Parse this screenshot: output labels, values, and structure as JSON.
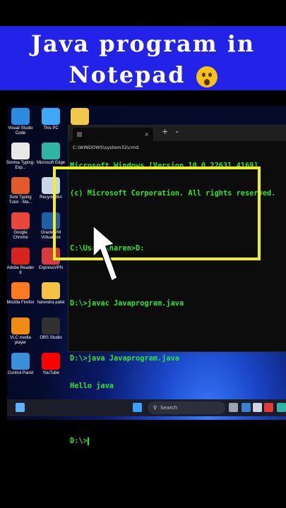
{
  "banner": {
    "line1": "Java program in",
    "line2": "Notepad",
    "emoji": "astonished-face"
  },
  "desktop_icons": [
    {
      "id": "vscode",
      "label": "Visual Studio Code",
      "color": "#2b8be0"
    },
    {
      "id": "thispc",
      "label": "This PC",
      "color": "#3fa9f5"
    },
    {
      "id": "folder",
      "label": "",
      "color": "#f2c84b"
    },
    {
      "id": "sonma",
      "label": "Sonma Typing-Exp...",
      "color": "#e8e8e8"
    },
    {
      "id": "edge",
      "label": "Microsoft Edge",
      "color": "#2fb5a3"
    },
    {
      "id": "soni",
      "label": "Soni Typing Tutor - Ma...",
      "color": "#e05a2b"
    },
    {
      "id": "recycle",
      "label": "Recycle Bin",
      "color": "#c9d6e8"
    },
    {
      "id": "chrome",
      "label": "Google Chrome",
      "color": "#e8453c"
    },
    {
      "id": "virtualbox",
      "label": "Oracle VM VirtualBox",
      "color": "#1f5fa8"
    },
    {
      "id": "adobe",
      "label": "Adobe Reader 8",
      "color": "#d8231f"
    },
    {
      "id": "expressvpn",
      "label": "ExpressVPN",
      "color": "#da3940"
    },
    {
      "id": "firefox",
      "label": "Mozilla Firefox",
      "color": "#ff7a1f"
    },
    {
      "id": "harendra",
      "label": "harendra patel",
      "color": "#f5c244"
    },
    {
      "id": "vlc",
      "label": "VLC media player",
      "color": "#f08a12"
    },
    {
      "id": "obs",
      "label": "OBS Studio",
      "color": "#303030"
    },
    {
      "id": "controlpanel",
      "label": "Control Panel",
      "color": "#3a8fd8"
    },
    {
      "id": "youtube",
      "label": "YouTube",
      "color": "#ff0000"
    }
  ],
  "terminal": {
    "tab_title": "C:\\WINDOWS\\system32\\cmd.",
    "tab_close": "×",
    "new_tab": "+",
    "dropdown": "⌄",
    "lines": [
      "Microsoft Windows [Version 10.0.22631.4169]",
      "(c) Microsoft Corporation. All rights reserved.",
      "",
      "C:\\Users\\haren>D:",
      "",
      "D:\\>javac Javaprogram.java",
      "",
      "D:\\>java Javaprogram.java",
      "Hello java",
      "",
      "D:\\>"
    ]
  },
  "taskbar": {
    "search_placeholder": "Search",
    "search_icon": "search-icon"
  },
  "colors": {
    "banner": "#2222e8",
    "terminal_text": "#2ee62e",
    "highlight": "#f3ef1b"
  }
}
